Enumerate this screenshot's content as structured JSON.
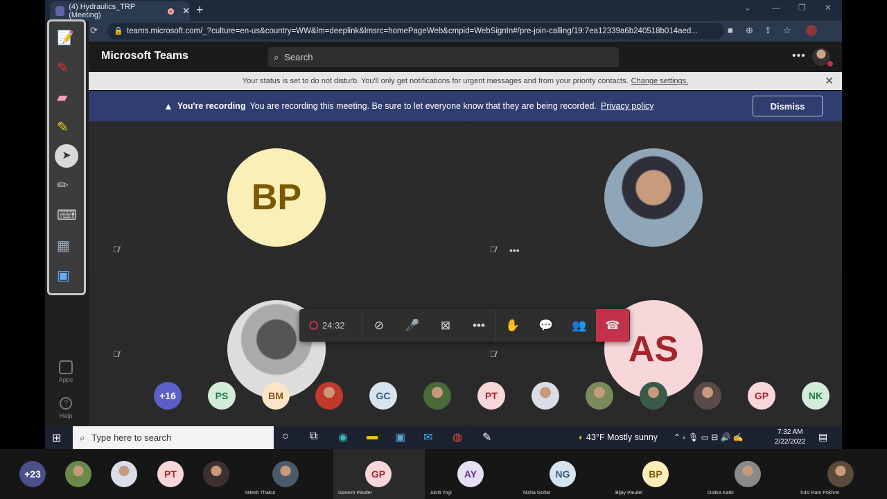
{
  "browser": {
    "tab_title": "(4) Hydraulics_TRP (Meeting)",
    "url": "teams.microsoft.com/_?culture=en-us&country=WW&lm=deeplink&lmsrc=homePageWeb&cmpid=WebSignIn#/pre-join-calling/19:7ea12339a6b240518b014aed..."
  },
  "teams": {
    "app_name": "Microsoft Teams",
    "search_placeholder": "Search"
  },
  "status_banner": {
    "text": "Your status is set to do not disturb. You'll only get notifications for urgent messages and from your priority contacts.",
    "link": "Change settings."
  },
  "recording_banner": {
    "title": "You're recording",
    "text": "You are recording this meeting. Be sure to let everyone know that they are being recorded.",
    "link": "Privacy policy",
    "dismiss": "Dismiss"
  },
  "tiles": [
    {
      "initials": "BP",
      "bg": "#fbefb8",
      "fg": "#7a5a00"
    },
    {
      "initials": "",
      "photo": true
    },
    {
      "initials": "",
      "photo": true
    },
    {
      "initials": "AS",
      "bg": "#f8d7da",
      "fg": "#a4262c"
    }
  ],
  "controls": {
    "timer": "24:32"
  },
  "gallery": [
    {
      "label": "+16",
      "bg": "#5b5fc7",
      "fg": "#fff"
    },
    {
      "label": "PS",
      "bg": "#d3ecd9",
      "fg": "#237b4b"
    },
    {
      "label": "BM",
      "bg": "#fbe5c9",
      "fg": "#8a5a1a"
    },
    {
      "label": "",
      "photo": "#c0392b"
    },
    {
      "label": "GC",
      "bg": "#d6e4f0",
      "fg": "#3a5a7a"
    },
    {
      "label": "",
      "photo": "#4a6a3a"
    },
    {
      "label": "PT",
      "bg": "#f8d7da",
      "fg": "#a4262c"
    },
    {
      "label": "",
      "photo": "#d8dde8"
    },
    {
      "label": "",
      "photo": "#7a8a5a"
    },
    {
      "label": "",
      "photo": "#3a5a4a"
    },
    {
      "label": "",
      "photo": "#5a4a4a"
    },
    {
      "label": "GP",
      "bg": "#f8d7da",
      "fg": "#a4262c"
    },
    {
      "label": "NK",
      "bg": "#d3ecd9",
      "fg": "#237b4b"
    }
  ],
  "left_rail": {
    "apps": "Apps",
    "help": "Help"
  },
  "taskbar": {
    "search_placeholder": "Type here to search",
    "weather": "43°F  Mostly sunny",
    "time": "7:32 AM",
    "date": "2/22/2022"
  },
  "strip": [
    {
      "label": "+23",
      "bg": "#4b4f8a",
      "fg": "#fff",
      "name": ""
    },
    {
      "label": "",
      "photo": "#6a8a4a",
      "name": ""
    },
    {
      "label": "",
      "photo": "#d8dde8",
      "name": ""
    },
    {
      "label": "PT",
      "bg": "#f8d7da",
      "fg": "#a4262c",
      "name": ""
    },
    {
      "label": "",
      "photo": "#3a3030",
      "name": ""
    },
    {
      "label": "",
      "photo": "#4a5a6a",
      "name": "Nitesh Thakur"
    },
    {
      "label": "GP",
      "bg": "#f8d7da",
      "fg": "#a4262c",
      "name": "Ganesh Paudel"
    },
    {
      "label": "AY",
      "bg": "#e8dff5",
      "fg": "#5c2e91",
      "name": "Akriti Yogi"
    },
    {
      "label": "NG",
      "bg": "#d6e4f0",
      "fg": "#3a5a7a",
      "name": "Nisha Godar"
    },
    {
      "label": "BP",
      "bg": "#fbefb8",
      "fg": "#7a5a00",
      "name": "Bijay Paudel"
    },
    {
      "label": "",
      "photo": "#8a8a8a",
      "name": "Ostika Karki"
    },
    {
      "label": "",
      "photo": "#5a4a3a",
      "name": "Tulsi Ram Pokhrel"
    }
  ]
}
